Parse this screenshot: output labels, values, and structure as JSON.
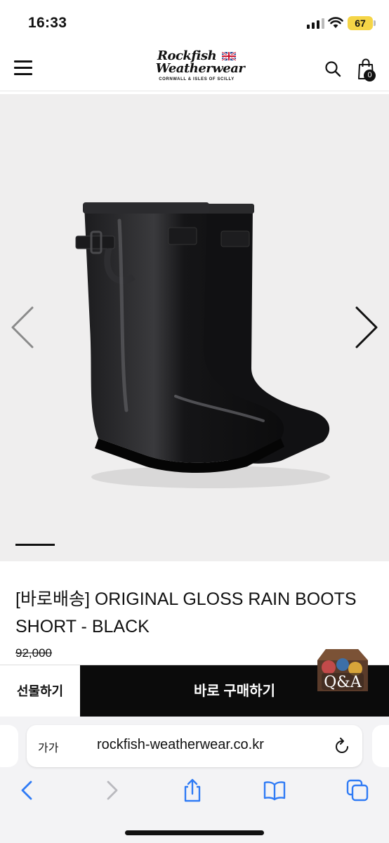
{
  "status_bar": {
    "time": "16:33",
    "battery_level": "67",
    "icons": [
      "signal-icon",
      "wifi-icon",
      "battery-icon"
    ]
  },
  "header": {
    "logo_line1": "Rockfish",
    "logo_line2": "Weatherwear",
    "logo_tagline": "CORNWALL & ISLES OF SCILLY",
    "cart_count": "0",
    "icons": [
      "menu-icon",
      "search-icon",
      "shopping-bag-icon"
    ]
  },
  "gallery": {
    "slide_index": 1,
    "icons": [
      "chevron-left-icon",
      "chevron-right-icon"
    ]
  },
  "product": {
    "title": "[바로배송] ORIGINAL GLOSS RAIN BOOTS SHORT - BLACK",
    "original_price": "92,000"
  },
  "actions": {
    "gift_label": "선물하기",
    "buy_label": "바로 구매하기",
    "qa_label": "Q&A"
  },
  "browser": {
    "text_size_label": "가가",
    "url": "rockfish-weatherwear.co.kr",
    "toolbar_icons": [
      "back-icon",
      "forward-icon",
      "share-icon",
      "bookmarks-icon",
      "tabs-icon"
    ]
  },
  "colors": {
    "buy_button_bg": "#0b0b0b",
    "gallery_bg": "#efeeee",
    "battery_bg": "#f5d547",
    "accent_link": "#2f7bf5"
  }
}
